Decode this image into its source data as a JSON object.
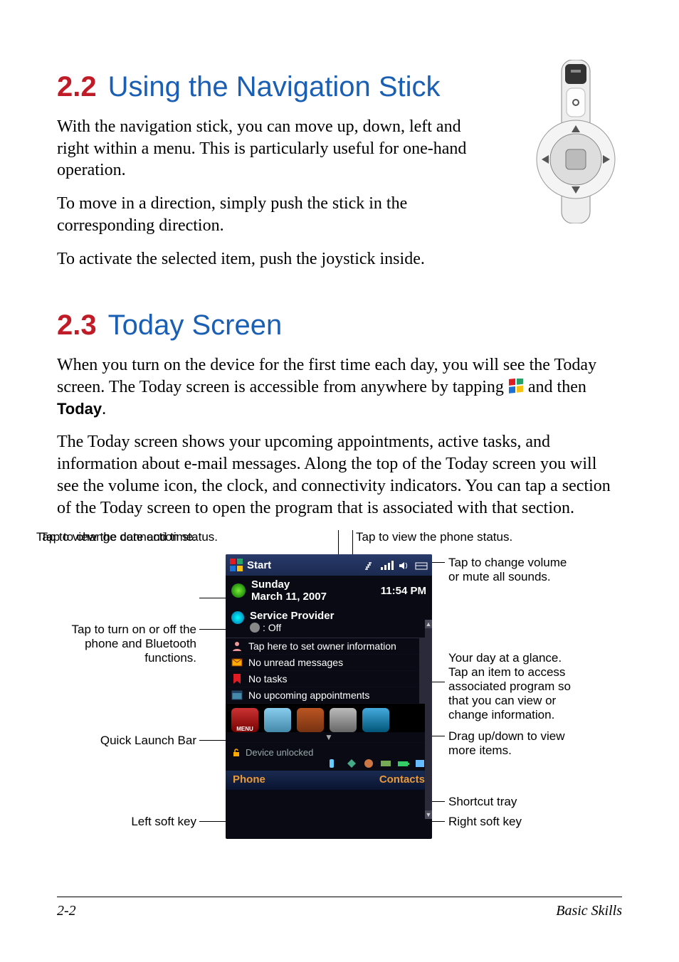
{
  "sec22": {
    "num": "2.2",
    "title": "Using the Navigation Stick",
    "p1": "With the navigation stick, you can move up, down, left and right within a menu. This is particularly useful for one-hand operation.",
    "p2": "To move in a direction, simply push the stick in the corresponding direction.",
    "p3": "To activate the selected item, push the joystick inside."
  },
  "sec23": {
    "num": "2.3",
    "title": "Today Screen",
    "p1a": "When you turn on the device for the first time each day, you will see the Today screen. The Today screen is accessible from anywhere by tapping ",
    "p1b": " and then ",
    "p1c_today": "Today",
    "p1d": ".",
    "p2": "The Today screen shows your upcoming appointments, active tasks, and information about e-mail messages. Along the top of the Today screen you will see the volume icon, the clock, and connectivity indicators. You can tap a section of the Today screen to open the program that is associated with that section."
  },
  "callouts": {
    "top_conn": "Tap to view the connection status.",
    "top_phone": "Tap to view the phone status.",
    "volume": "Tap to change volume or mute all sounds.",
    "datetime": "Tap to change date and time.",
    "wireless": "Tap to turn on or off the phone and Bluetooth functions.",
    "glance": "Your day at a glance. Tap an item to access associated program so that you can view or change information.",
    "quicklaunch": "Quick Launch Bar",
    "drag": "Drag up/down to view more items.",
    "shortcut": "Shortcut tray",
    "leftsk": "Left soft key",
    "rightsk": "Right soft key"
  },
  "phone": {
    "start": "Start",
    "day": "Sunday",
    "date": "March 11, 2007",
    "time": "11:54 PM",
    "service": "Service Provider",
    "bt_off": ": Off",
    "owner": "Tap here to set owner information",
    "unread": "No unread messages",
    "tasks": "No tasks",
    "appt": "No upcoming appointments",
    "menu": "MENU",
    "unlocked": "Device unlocked",
    "sk_left": "Phone",
    "sk_right": "Contacts"
  },
  "footer": {
    "page": "2-2",
    "section": "Basic Skills"
  }
}
